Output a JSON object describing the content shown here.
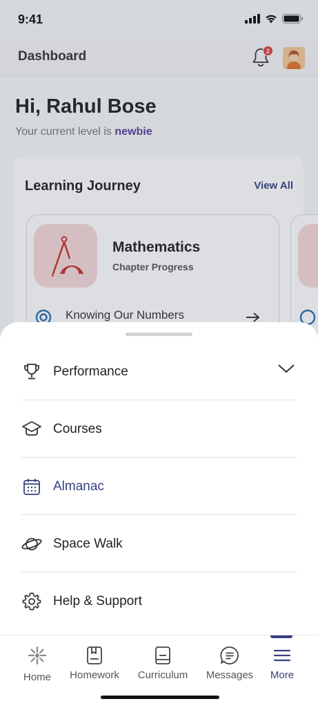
{
  "status_bar": {
    "time": "9:41"
  },
  "header": {
    "title": "Dashboard",
    "notification_count": "2"
  },
  "greeting": {
    "title": "Hi, Rahul Bose",
    "level_prefix": "Your current level is ",
    "level_value": "newbie"
  },
  "journey": {
    "title": "Learning Journey",
    "view_all": "View All",
    "subject": {
      "name": "Mathematics",
      "subtitle": "Chapter Progress",
      "chapter": "Knowing Our Numbers"
    }
  },
  "sheet": {
    "items": [
      {
        "label": "Performance",
        "icon": "trophy-icon",
        "expandable": true
      },
      {
        "label": "Courses",
        "icon": "graduation-cap-icon"
      },
      {
        "label": "Almanac",
        "icon": "calendar-icon",
        "active": true
      },
      {
        "label": "Space Walk",
        "icon": "planet-icon"
      },
      {
        "label": "Help & Support",
        "icon": "gear-icon"
      }
    ]
  },
  "nav": {
    "items": [
      {
        "label": "Home",
        "icon": "home-sparkle-icon"
      },
      {
        "label": "Homework",
        "icon": "homework-icon"
      },
      {
        "label": "Curriculum",
        "icon": "book-icon"
      },
      {
        "label": "Messages",
        "icon": "chat-icon"
      },
      {
        "label": "More",
        "icon": "menu-icon",
        "active": true
      }
    ]
  },
  "colors": {
    "accent": "#36407e",
    "level": "#5a3e9c",
    "badge": "#e23b3b",
    "subject_bg": "#f7d8d8"
  }
}
